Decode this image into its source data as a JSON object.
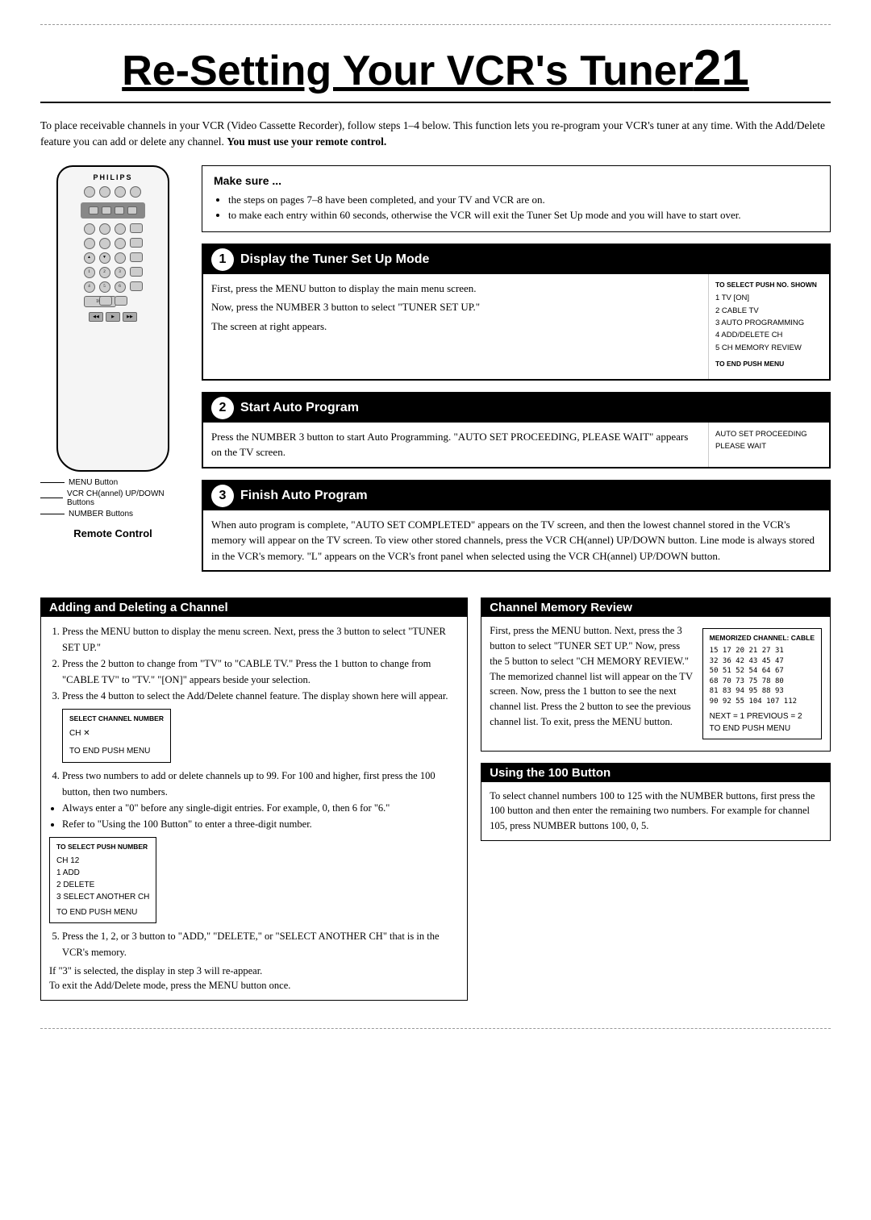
{
  "page": {
    "title": "Re-Setting Your VCR's Tuner",
    "page_number": "21",
    "border_top": "- - - - - - - - - - - - - - - - - - - - - - - - - - - - - - -",
    "border_bottom": "- - - - - - - - - - - - - - - - - - - - - - - - - - - - - - -"
  },
  "intro": {
    "text": "To place receivable channels in your VCR (Video Cassette Recorder), follow steps 1–4 below. This function lets you re-program your VCR's tuner at any time. With the Add/Delete feature you can add or delete any channel.",
    "bold_text": "You must use your remote control."
  },
  "remote": {
    "brand": "PHILIPS",
    "caption": "Remote Control",
    "labels": [
      "MENU Button",
      "VCR CH(annel) UP/DOWN Buttons",
      "NUMBER Buttons"
    ]
  },
  "make_sure": {
    "title": "Make sure ...",
    "items": [
      "the steps on pages 7–8 have been completed, and your TV and VCR are on.",
      "to make each entry within 60 seconds, otherwise the VCR will exit the Tuner Set Up mode and you will have to start over."
    ]
  },
  "step1": {
    "header": "Display the Tuner Set Up Mode",
    "number": "1",
    "text1": "First, press the MENU button to display the main menu screen.",
    "text2": "Now, press the NUMBER 3 button to select \"TUNER SET UP.\"",
    "text3": "The screen at right appears.",
    "sidebar_title": "TO SELECT PUSH NO. SHOWN",
    "sidebar_items": [
      "1 TV          [ON]",
      "2 CABLE TV",
      "3 AUTO PROGRAMMING",
      "4 ADD/DELETE CH",
      "5 CH MEMORY REVIEW"
    ],
    "sidebar_footer": "TO END PUSH MENU"
  },
  "step2": {
    "header": "Start Auto Program",
    "number": "2",
    "text": "Press the NUMBER 3 button to start Auto Programming. \"AUTO SET PROCEEDING, PLEASE WAIT\" appears on the TV screen.",
    "sidebar_line1": "AUTO SET PROCEEDING",
    "sidebar_line2": "PLEASE WAIT"
  },
  "step3": {
    "header": "Finish Auto Program",
    "number": "3",
    "text": "When auto program is complete, \"AUTO SET COMPLETED\" appears on the TV screen, and then the lowest channel stored in the VCR's memory will appear on the TV screen. To view other stored channels, press the VCR CH(annel) UP/DOWN button. Line mode is always stored in the VCR's memory. \"L\" appears on the VCR's front panel when selected using the VCR CH(annel) UP/DOWN button."
  },
  "adding_deleting": {
    "header": "Adding and Deleting a Channel",
    "steps": [
      "Press the MENU button to display the menu screen. Next, press the 3 button to select \"TUNER SET UP.\"",
      "Press the 2 button to change from \"TV\" to \"CABLE TV.\" Press the 1 button to change from \"CABLE TV\" to \"TV.\" \"[ON]\" appears beside your selection.",
      "Press the 4 button to select the Add/Delete channel feature. The display shown here will appear.",
      "Press two numbers to add or delete channels up to 99. For 100 and higher, first press the 100 button, then two numbers.",
      "Always enter a \"0\" before any single-digit entries. For example, 0, then 6 for \"6.\"",
      "Refer to \"Using the 100 Button\" to enter a three-digit number.",
      "Press the 1, 2, or 3 button to \"ADD,\" \"DELETE,\" or \"SELECT ANOTHER CH\" that is in the VCR's memory.",
      "If \"3\" is selected, the display in step 3 will re-appear.",
      "To exit the Add/Delete mode, press the MENU button once."
    ],
    "display1_title": "SELECT CHANNEL NUMBER",
    "display1_ch": "CH ✕",
    "display1_footer": "TO END PUSH MENU",
    "display2_title": "TO SELECT PUSH NUMBER",
    "display2_ch": "CH 12",
    "display2_items": [
      "1 ADD",
      "2 DELETE",
      "3 SELECT ANOTHER CH"
    ],
    "display2_footer": "TO END PUSH MENU"
  },
  "channel_memory": {
    "header": "Channel Memory Review",
    "text": "First, press the MENU button. Next, press the 3 button to select \"TUNER SET UP.\" Now, press the 5 button to select \"CH MEMORY REVIEW.\" The memorized channel list will appear on the TV screen. Now, press the 1 button to see the next channel list. Press the 2 button to see the previous channel list. To exit, press the MENU button.",
    "table_header": "MEMORIZED CHANNEL: CABLE",
    "channels": [
      "15  17  20  21  27  31",
      "32  36  42  43  45  47",
      "50  51  52  54  64  67",
      "68  70  73  75  78  80",
      "81  83  94  95  88  93",
      "90  92  55  104 107 112"
    ],
    "table_footer1": "NEXT = 1  PREVIOUS = 2",
    "table_footer2": "TO END PUSH MENU"
  },
  "using_100": {
    "header": "Using the 100 Button",
    "text": "To select channel numbers 100 to 125 with the NUMBER buttons, first press the 100 button and then enter the remaining two numbers. For example for channel 105, press NUMBER buttons 100, 0, 5."
  }
}
